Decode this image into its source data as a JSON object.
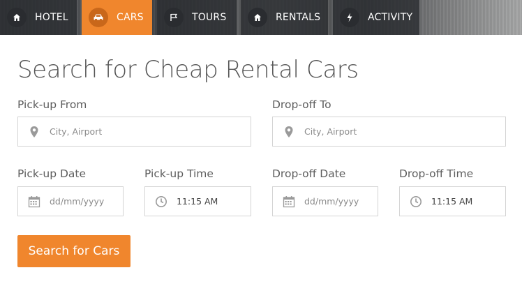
{
  "nav": {
    "tabs": [
      {
        "label": "HOTEL",
        "icon": "home-icon"
      },
      {
        "label": "CARS",
        "icon": "car-icon",
        "active": true
      },
      {
        "label": "TOURS",
        "icon": "flag-icon"
      },
      {
        "label": "RENTALS",
        "icon": "home-icon"
      },
      {
        "label": "ACTIVITY",
        "icon": "bolt-icon"
      }
    ]
  },
  "main": {
    "title": "Search for Cheap Rental Cars",
    "pickup_from": {
      "label": "Pick-up From",
      "placeholder": "City, Airport",
      "icon": "map-marker-icon"
    },
    "dropoff_to": {
      "label": "Drop-off To",
      "placeholder": "City, Airport",
      "icon": "map-marker-icon"
    },
    "pickup_date": {
      "label": "Pick-up Date",
      "placeholder": "dd/mm/yyyy",
      "icon": "calendar-icon"
    },
    "pickup_time": {
      "label": "Pick-up Time",
      "value": "11:15 AM",
      "icon": "clock-icon"
    },
    "dropoff_date": {
      "label": "Drop-off Date",
      "placeholder": "dd/mm/yyyy",
      "icon": "calendar-icon"
    },
    "dropoff_time": {
      "label": "Drop-off Time",
      "value": "11:15 AM",
      "icon": "clock-icon"
    },
    "search_button": "Search for Cars"
  },
  "colors": {
    "accent": "#f0862d",
    "tab_bg": "#2c2e32",
    "text": "#555555",
    "border": "#d4d4d4"
  }
}
